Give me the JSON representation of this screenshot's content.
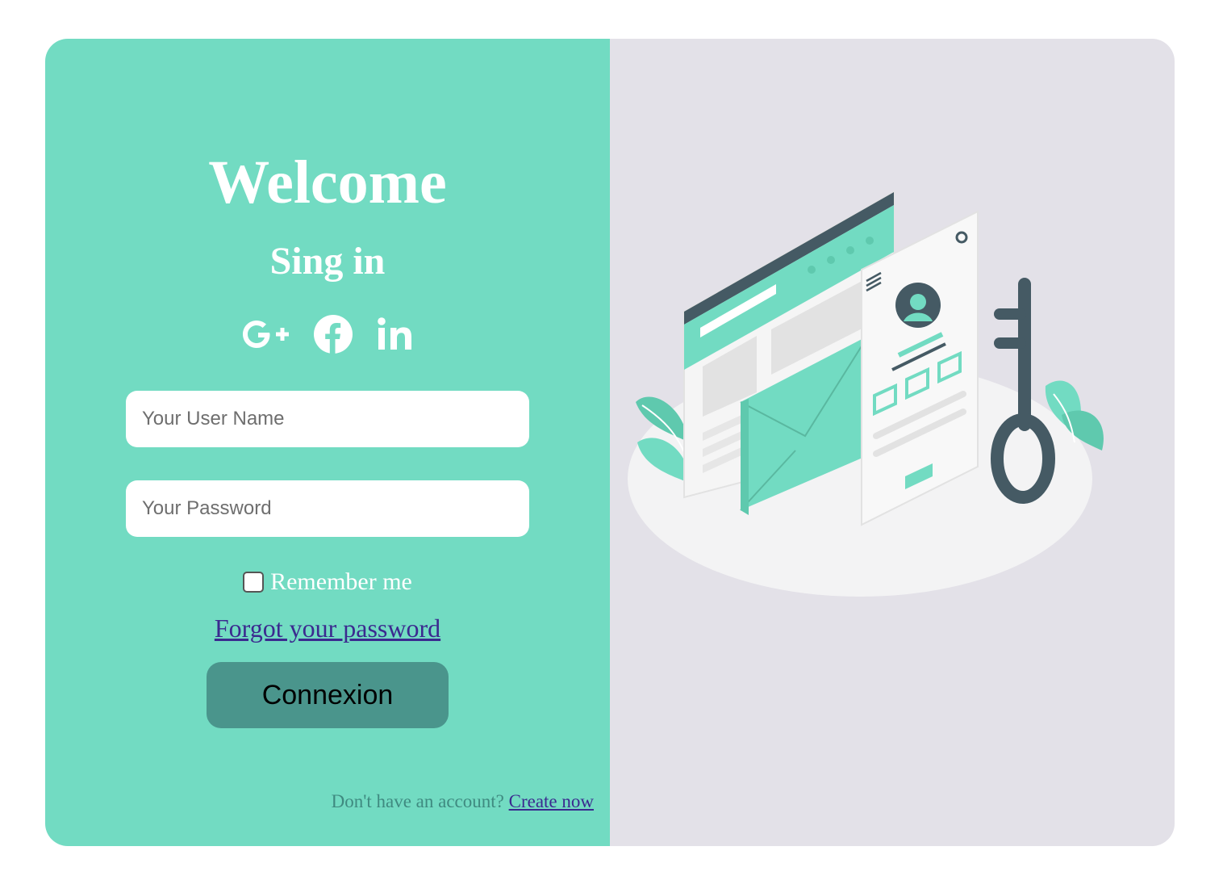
{
  "left_panel": {
    "title": "Welcome",
    "subtitle": "Sing in",
    "social_icons": [
      "google-plus-icon",
      "facebook-icon",
      "linkedin-icon"
    ]
  },
  "form": {
    "username_placeholder": "Your User Name",
    "password_placeholder": "Your Password",
    "remember_label": "Remember me",
    "remember_checked": false,
    "forgot_link": "Forgot your password",
    "submit_label": "Connexion"
  },
  "footer": {
    "prompt": "Don't have an account?",
    "create_link": "Create now"
  },
  "colors": {
    "left_bg": "#72dbc2",
    "right_bg": "#e3e1e8",
    "button_bg": "#4a958c",
    "link": "#3b2a8f"
  }
}
